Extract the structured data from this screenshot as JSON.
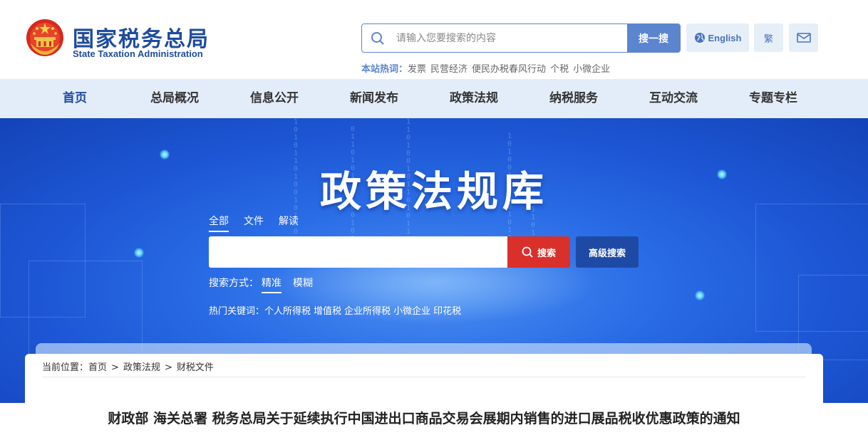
{
  "header": {
    "logo_cn": "国家税务总局",
    "logo_en": "State Taxation Administration",
    "search_placeholder": "请输入您要搜索的内容",
    "search_button": "搜一搜",
    "english_label": "English",
    "traditional_label": "繁",
    "hotwords_label": "本站热词：",
    "hotwords": [
      "发票",
      "民营经济",
      "便民办税春风行动",
      "个税",
      "小微企业"
    ]
  },
  "nav": {
    "items": [
      "首页",
      "总局概况",
      "信息公开",
      "新闻发布",
      "政策法规",
      "纳税服务",
      "互动交流",
      "专题专栏"
    ],
    "active": "首页"
  },
  "banner": {
    "title": "政策法规库",
    "tabs": [
      "全部",
      "文件",
      "解读"
    ],
    "active_tab": "全部",
    "search_button": "搜索",
    "advanced_button": "高级搜索",
    "mode_label": "搜索方式：",
    "modes": [
      "精准",
      "模糊"
    ],
    "active_mode": "精准",
    "keywords_label": "热门关键词：",
    "keywords": [
      "个人所得税",
      "增值税",
      "企业所得税",
      "小微企业",
      "印花税"
    ]
  },
  "breadcrumb": {
    "prefix": "当前位置：",
    "items": [
      "首页",
      "政策法规",
      "财税文件"
    ],
    "separator": ">"
  },
  "article": {
    "title": "财政部 海关总署 税务总局关于延续执行中国进出口商品交易会展期内销售的进口展品税收优惠政策的通知"
  },
  "colors": {
    "brand_blue": "#1f4c9e",
    "search_button": "#5b85cf",
    "nav_bg": "#e3edf9",
    "red_search": "#d9302c",
    "advanced_search": "#1e4aa6"
  }
}
